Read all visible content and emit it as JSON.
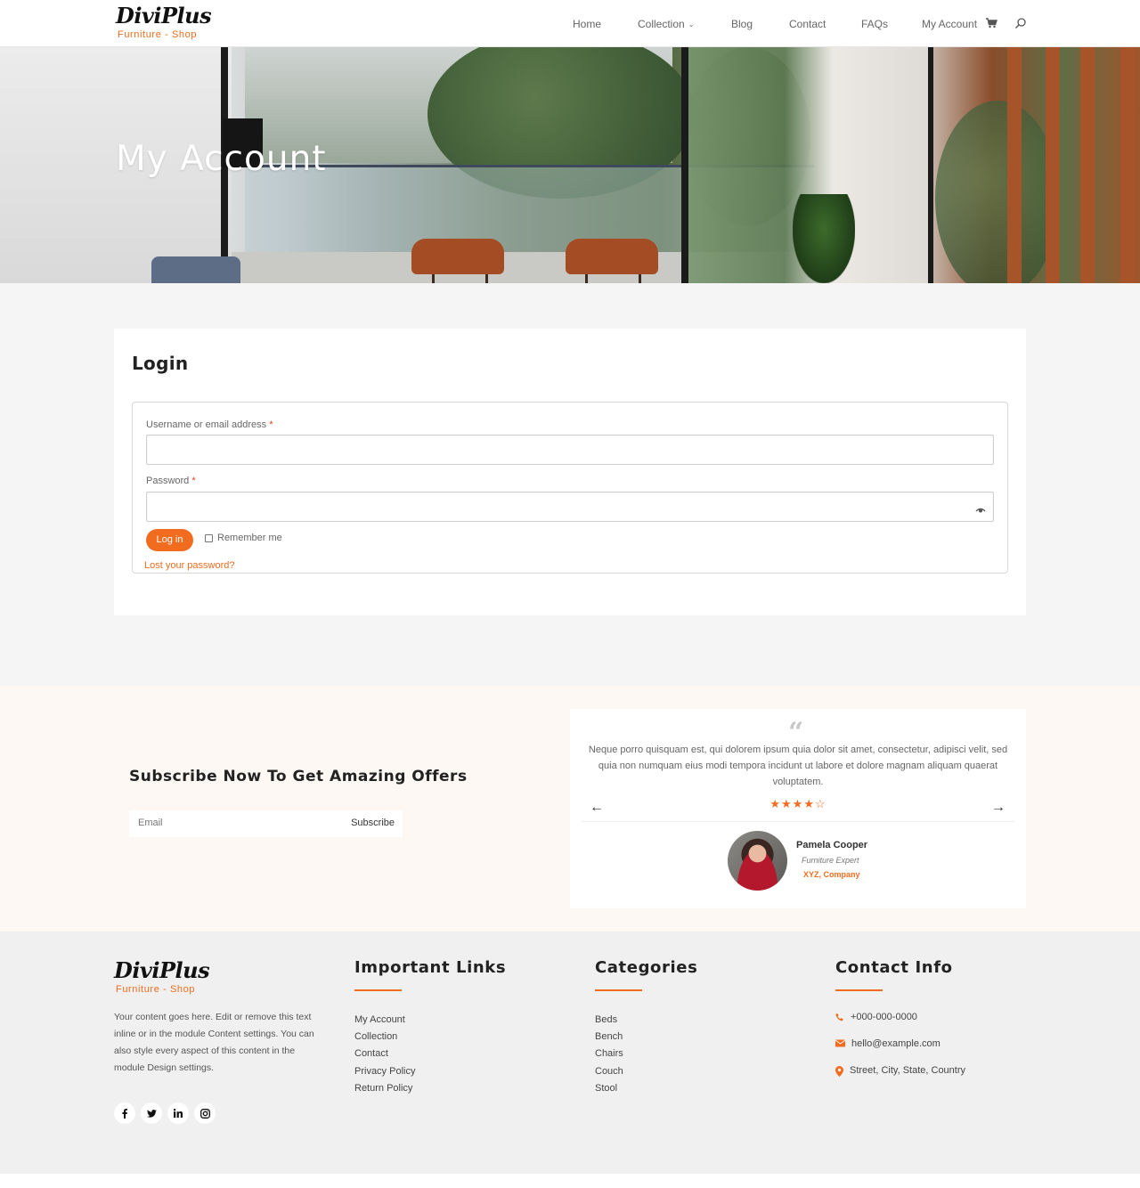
{
  "brand": {
    "name": "DiviPlus",
    "tagline": "Furniture - Shop",
    "accent_color": "#f26c1f"
  },
  "nav": {
    "items": [
      {
        "label": "Home"
      },
      {
        "label": "Collection",
        "has_dropdown": true
      },
      {
        "label": "Blog"
      },
      {
        "label": "Contact"
      },
      {
        "label": "FAQs"
      },
      {
        "label": "My Account"
      }
    ],
    "icons": [
      "cart-icon",
      "search-icon"
    ]
  },
  "hero": {
    "title": "My Account"
  },
  "login": {
    "title": "Login",
    "username_label": "Username or email address",
    "username_value": "",
    "password_label": "Password",
    "password_value": "",
    "required_mark": "*",
    "submit_label": "Log in",
    "remember_label": "Remember me",
    "remember_checked": false,
    "lost_password_label": "Lost your password?"
  },
  "subscribe": {
    "title": "Subscribe Now To Get Amazing Offers",
    "email_placeholder": "Email",
    "button_label": "Subscribe"
  },
  "testimonial": {
    "quote_mark": "“",
    "text": "Neque porro quisquam est, qui dolorem ipsum quia dolor sit amet, consectetur, adipisci velit, sed quia non numquam eius modi tempora incidunt ut labore et dolore magnam aliquam quaerat voluptatem.",
    "rating": 4,
    "rating_max": 5,
    "stars_display": "★★★★☆",
    "prev_arrow": "←",
    "next_arrow": "→",
    "name": "Pamela Cooper",
    "role": "Furniture Expert",
    "company": "XYZ, Company"
  },
  "footer": {
    "about": "Your content goes here. Edit or remove this text inline or in the module Content settings. You can also style every aspect of this content in the module Design settings.",
    "socials": [
      {
        "name": "facebook",
        "glyph": "f"
      },
      {
        "name": "twitter",
        "glyph": "t"
      },
      {
        "name": "linkedin",
        "glyph": "in"
      },
      {
        "name": "instagram",
        "glyph": "ig"
      }
    ],
    "important_links": {
      "heading": "Important Links",
      "items": [
        "My Account",
        "Collection",
        "Contact",
        "Privacy Policy",
        "Return Policy"
      ]
    },
    "categories": {
      "heading": "Categories",
      "items": [
        "Beds",
        "Bench",
        "Chairs",
        "Couch",
        "Stool"
      ]
    },
    "contact": {
      "heading": "Contact Info",
      "phone": "+000-000-0000",
      "email": "hello@example.com",
      "address": "Street, City, State, Country"
    }
  }
}
